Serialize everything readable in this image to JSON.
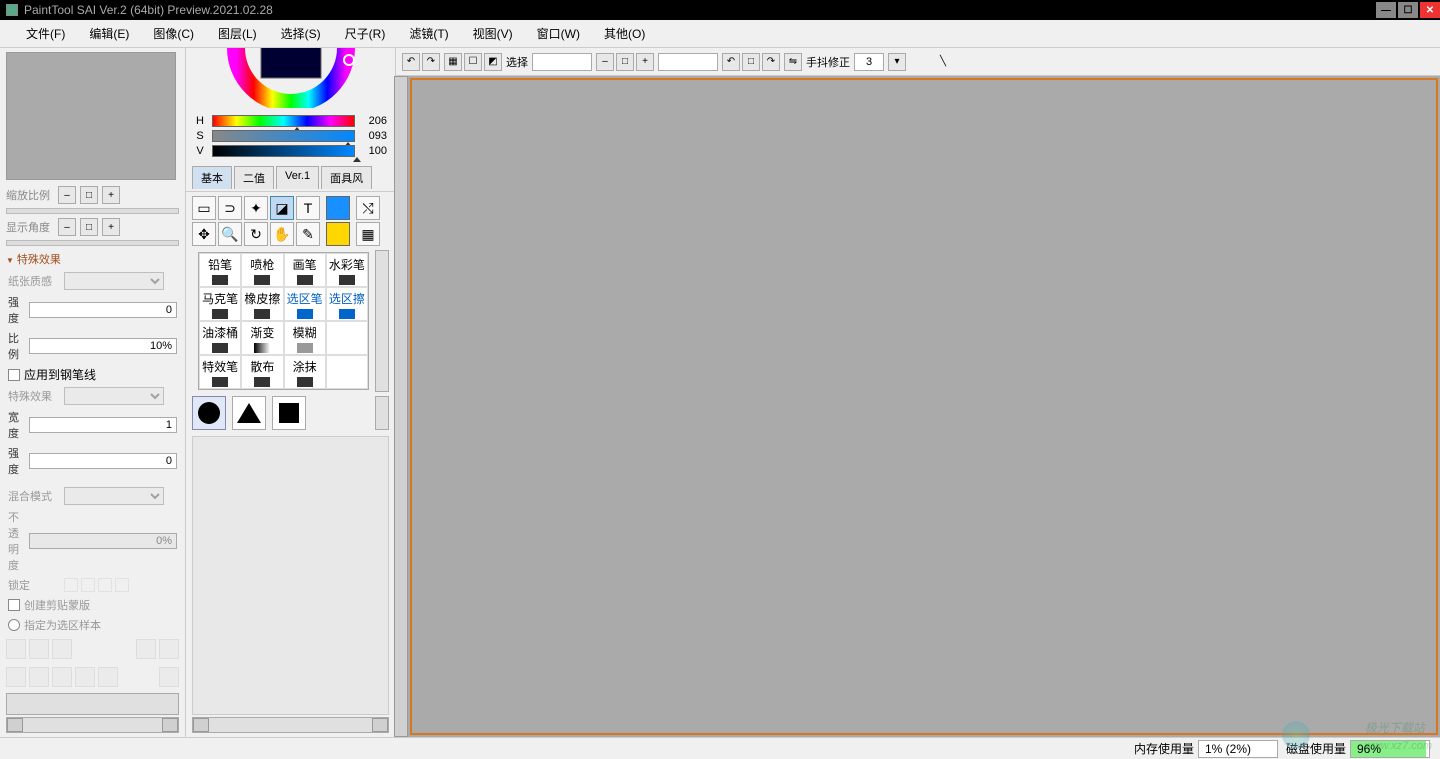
{
  "title": "PaintTool SAI Ver.2 (64bit) Preview.2021.02.28",
  "menu": [
    "文件(F)",
    "编辑(E)",
    "图像(C)",
    "图层(L)",
    "选择(S)",
    "尺子(R)",
    "滤镜(T)",
    "视图(V)",
    "窗口(W)",
    "其他(O)"
  ],
  "leftPanel": {
    "zoomLabel": "缩放比例",
    "angleLabel": "显示角度",
    "effectsHeader": "特殊效果",
    "paperTexture": "纸张质感",
    "strength": "强度",
    "strengthVal": "0",
    "scale": "比例",
    "scaleVal": "10%",
    "applyPen": "应用到钢笔线",
    "specialEffect": "特殊效果",
    "width": "宽度",
    "widthVal": "1",
    "strength2": "强度",
    "strength2Val": "0",
    "blendMode": "混合模式",
    "opacity": "不透明度",
    "opacityVal": "0%",
    "lock": "锁定",
    "clipMask": "创建剪贴蒙版",
    "selSample": "指定为选区样本"
  },
  "color": {
    "h": "H",
    "hVal": "206",
    "s": "S",
    "sVal": "093",
    "v": "V",
    "vVal": "100"
  },
  "toolTabs": [
    "基本",
    "二值",
    "Ver.1",
    "面具风"
  ],
  "brushes": [
    "铅笔",
    "喷枪",
    "画笔",
    "水彩笔",
    "马克笔",
    "橡皮擦",
    "选区笔",
    "选区擦",
    "油漆桶",
    "渐变",
    "模糊",
    "特效笔",
    "散布",
    "涂抹"
  ],
  "canvasToolbar": {
    "selectLabel": "选择",
    "stabLabel": "手抖修正",
    "stabVal": "3"
  },
  "status": {
    "memLabel": "内存使用量",
    "memVal": "1% (2%)",
    "diskLabel": "磁盘使用量",
    "diskVal": "96%"
  },
  "watermark": "极光下载站",
  "watermarkUrl": "www.xz7.com"
}
